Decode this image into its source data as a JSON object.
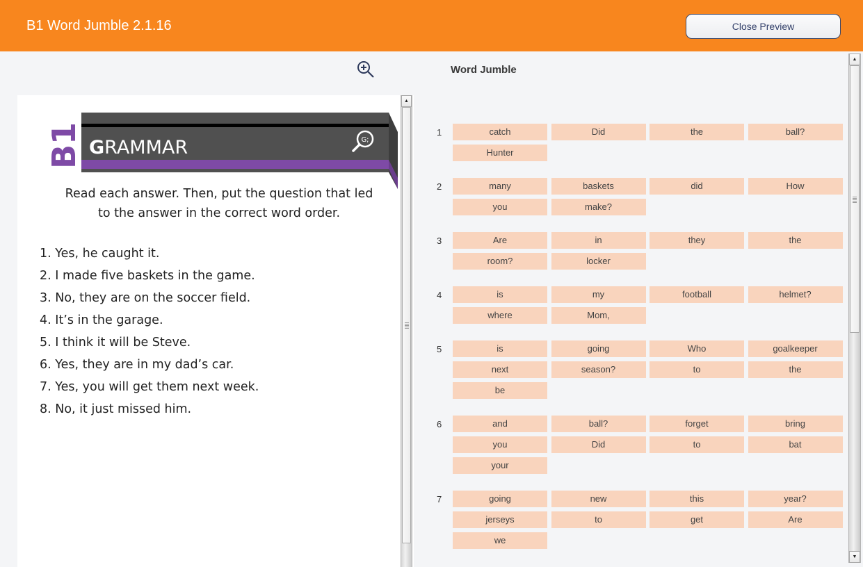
{
  "header": {
    "title": "B1 Word Jumble 2.1.16",
    "close_button": "Close Preview"
  },
  "colors": {
    "header_bg": "#f8861e",
    "tile_bg": "#f9d4bd",
    "brand_purple": "#7e4aa6",
    "banner_gray": "#505050"
  },
  "toolbar": {
    "zoom_icon": "zoom-in-icon"
  },
  "document": {
    "logo": {
      "level": "B1",
      "title_bold": "G",
      "title_rest": "RAMMAR",
      "badge": "G;"
    },
    "instructions": "Read each answer. Then, put the question that led to the answer in the correct word order.",
    "answers": [
      "1. Yes, he caught it.",
      "2. I made five baskets in the game.",
      "3. No, they are on the soccer field.",
      "4. It’s in the garage.",
      "5. I think it will be Steve.",
      "6. Yes, they are in my dad’s car.",
      "7. Yes, you will get them next week.",
      "8. No, it just missed him."
    ]
  },
  "word_jumble": {
    "title": "Word Jumble",
    "items": [
      {
        "number": "1",
        "words": [
          "catch",
          "Did",
          "the",
          "ball?",
          "Hunter"
        ]
      },
      {
        "number": "2",
        "words": [
          "many",
          "baskets",
          "did",
          "How",
          "you",
          "make?"
        ]
      },
      {
        "number": "3",
        "words": [
          "Are",
          "in",
          "they",
          "the",
          "room?",
          "locker"
        ]
      },
      {
        "number": "4",
        "words": [
          "is",
          "my",
          "football",
          "helmet?",
          "where",
          "Mom,"
        ]
      },
      {
        "number": "5",
        "words": [
          "is",
          "going",
          "Who",
          "goalkeeper",
          "next",
          "season?",
          "to",
          "the",
          "be"
        ]
      },
      {
        "number": "6",
        "words": [
          "and",
          "ball?",
          "forget",
          "bring",
          "you",
          "Did",
          "to",
          "bat",
          "your"
        ]
      },
      {
        "number": "7",
        "words": [
          "going",
          "new",
          "this",
          "year?",
          "jerseys",
          "to",
          "get",
          "Are",
          "we"
        ]
      }
    ]
  },
  "scrollbars": {
    "document_scroll_position": 0.0,
    "word_jumble_scroll_position": 0.0
  }
}
